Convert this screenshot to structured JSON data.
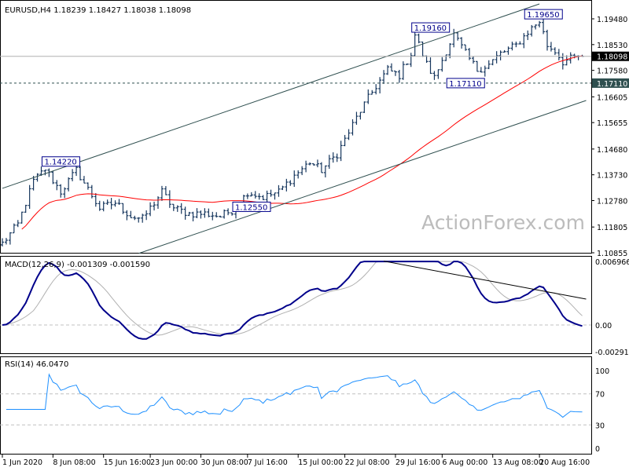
{
  "header": {
    "title": "EURUSD,H4  1.18239 1.18427 1.18038 1.18098"
  },
  "watermark": "ActionForex.com",
  "colors": {
    "bars": "#17375e",
    "ma": "#ff0000",
    "macd": "#00008b",
    "signal": "#b0b0b0",
    "rsi": "#1e90ff",
    "current_bg": "#000000",
    "level_bg": "#2f4f4f"
  },
  "chart_data": [
    {
      "type": "ohlc",
      "title": "EURUSD,H4",
      "ohlc_last": {
        "open": "1.18239",
        "high": "1.18427",
        "low": "1.18038",
        "close": "1.18098"
      },
      "bars": 150,
      "anchors": [
        [
          0,
          1.112
        ],
        [
          4,
          1.119
        ],
        [
          8,
          1.135
        ],
        [
          11,
          1.1395
        ],
        [
          15,
          1.131
        ],
        [
          19,
          1.139
        ],
        [
          22,
          1.132
        ],
        [
          25,
          1.125
        ],
        [
          29,
          1.127
        ],
        [
          33,
          1.122
        ],
        [
          36,
          1.121
        ],
        [
          41,
          1.131
        ],
        [
          44,
          1.125
        ],
        [
          48,
          1.123
        ],
        [
          52,
          1.123
        ],
        [
          56,
          1.122
        ],
        [
          60,
          1.125
        ],
        [
          63,
          1.131
        ],
        [
          67,
          1.129
        ],
        [
          71,
          1.131
        ],
        [
          75,
          1.137
        ],
        [
          79,
          1.142
        ],
        [
          82,
          1.139
        ],
        [
          86,
          1.145
        ],
        [
          89,
          1.153
        ],
        [
          92,
          1.161
        ],
        [
          96,
          1.17
        ],
        [
          99,
          1.176
        ],
        [
          102,
          1.174
        ],
        [
          105,
          1.182
        ],
        [
          106,
          1.189
        ],
        [
          109,
          1.178
        ],
        [
          111,
          1.173
        ],
        [
          114,
          1.183
        ],
        [
          116,
          1.189
        ],
        [
          119,
          1.182
        ],
        [
          122,
          1.176
        ],
        [
          125,
          1.178
        ],
        [
          128,
          1.182
        ],
        [
          132,
          1.185
        ],
        [
          135,
          1.19
        ],
        [
          138,
          1.194
        ],
        [
          140,
          1.185
        ],
        [
          142,
          1.183
        ],
        [
          144,
          1.179
        ],
        [
          146,
          1.18
        ],
        [
          148,
          1.181
        ]
      ],
      "yticks": [
        "1.19480",
        "1.18530",
        "1.17580",
        "1.16605",
        "1.15655",
        "1.14680",
        "1.13730",
        "1.12780",
        "1.11805",
        "1.10855"
      ],
      "ylim": [
        1.10855,
        1.1948
      ],
      "current_price": "1.18098",
      "support_level": "1.17110",
      "annotations": [
        {
          "text": "1.14220",
          "bar": 11,
          "price": 1.1422
        },
        {
          "text": "1.12550",
          "bar": 60,
          "price": 1.1255
        },
        {
          "text": "1.19160",
          "bar": 106,
          "price": 1.1916
        },
        {
          "text": "1.17110",
          "bar": 115,
          "price": 1.1711
        },
        {
          "text": "1.19650",
          "bar": 135,
          "price": 1.1965
        }
      ],
      "channel_upper": [
        [
          0,
          1.1323
        ],
        [
          138,
          1.2003
        ]
      ],
      "channel_lower": [
        [
          35,
          1.1083
        ],
        [
          150,
          1.1647
        ]
      ],
      "ma_period": 55,
      "xticks": [
        {
          "bar": 0,
          "label": "1 Jun 2020"
        },
        {
          "bar": 13,
          "label": "8 Jun 08:00"
        },
        {
          "bar": 26,
          "label": "15 Jun 16:00"
        },
        {
          "bar": 38,
          "label": "23 Jun 00:00"
        },
        {
          "bar": 51,
          "label": "30 Jun 08:00"
        },
        {
          "bar": 63,
          "label": "7 Jul 16:00"
        },
        {
          "bar": 76,
          "label": "15 Jul 00:00"
        },
        {
          "bar": 88,
          "label": "22 Jul 08:00"
        },
        {
          "bar": 101,
          "label": "29 Jul 16:00"
        },
        {
          "bar": 113,
          "label": "6 Aug 00:00"
        },
        {
          "bar": 126,
          "label": "13 Aug 08:00"
        },
        {
          "bar": 138,
          "label": "20 Aug 16:00"
        }
      ]
    },
    {
      "type": "line",
      "title": "MACD(12,26,9) -0.001309 -0.001590",
      "yticks": [
        "0.006966",
        "0.00",
        "-0.002913"
      ],
      "ylim": [
        -0.002913,
        0.006966
      ],
      "trendline": [
        [
          98,
          0.007
        ],
        [
          150,
          0.00284
        ]
      ]
    },
    {
      "type": "line",
      "title": "RSI(14) 46.0470",
      "yticks": [
        "100",
        "70",
        "30",
        "0"
      ],
      "ylim": [
        0,
        100
      ],
      "levels": [
        70,
        30
      ]
    }
  ]
}
